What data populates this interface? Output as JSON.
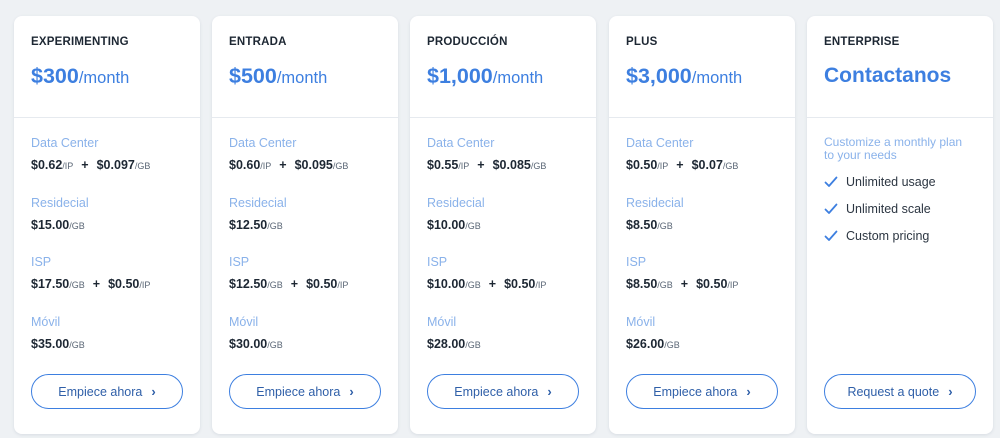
{
  "plans": [
    {
      "tier": "EXPERIMENTING",
      "price": "$300",
      "per": "/month",
      "groups": [
        {
          "label": "Data Center",
          "parts": [
            {
              "value": "$0.62",
              "unit": "/IP"
            },
            {
              "value": "$0.097",
              "unit": "/GB"
            }
          ]
        },
        {
          "label": "Residecial",
          "parts": [
            {
              "value": "$15.00",
              "unit": "/GB"
            }
          ]
        },
        {
          "label": "ISP",
          "parts": [
            {
              "value": "$17.50",
              "unit": "/GB"
            },
            {
              "value": "$0.50",
              "unit": "/IP"
            }
          ]
        },
        {
          "label": "Móvil",
          "parts": [
            {
              "value": "$35.00",
              "unit": "/GB"
            }
          ]
        }
      ],
      "cta": "Empiece ahora"
    },
    {
      "tier": "ENTRADA",
      "price": "$500",
      "per": "/month",
      "groups": [
        {
          "label": "Data Center",
          "parts": [
            {
              "value": "$0.60",
              "unit": "/IP"
            },
            {
              "value": "$0.095",
              "unit": "/GB"
            }
          ]
        },
        {
          "label": "Residecial",
          "parts": [
            {
              "value": "$12.50",
              "unit": "/GB"
            }
          ]
        },
        {
          "label": "ISP",
          "parts": [
            {
              "value": "$12.50",
              "unit": "/GB"
            },
            {
              "value": "$0.50",
              "unit": "/IP"
            }
          ]
        },
        {
          "label": "Móvil",
          "parts": [
            {
              "value": "$30.00",
              "unit": "/GB"
            }
          ]
        }
      ],
      "cta": "Empiece ahora"
    },
    {
      "tier": "PRODUCCIÓN",
      "price": "$1,000",
      "per": "/month",
      "groups": [
        {
          "label": "Data Center",
          "parts": [
            {
              "value": "$0.55",
              "unit": "/IP"
            },
            {
              "value": "$0.085",
              "unit": "/GB"
            }
          ]
        },
        {
          "label": "Residecial",
          "parts": [
            {
              "value": "$10.00",
              "unit": "/GB"
            }
          ]
        },
        {
          "label": "ISP",
          "parts": [
            {
              "value": "$10.00",
              "unit": "/GB"
            },
            {
              "value": "$0.50",
              "unit": "/IP"
            }
          ]
        },
        {
          "label": "Móvil",
          "parts": [
            {
              "value": "$28.00",
              "unit": "/GB"
            }
          ]
        }
      ],
      "cta": "Empiece ahora"
    },
    {
      "tier": "PLUS",
      "price": "$3,000",
      "per": "/month",
      "groups": [
        {
          "label": "Data Center",
          "parts": [
            {
              "value": "$0.50",
              "unit": "/IP"
            },
            {
              "value": "$0.07",
              "unit": "/GB"
            }
          ]
        },
        {
          "label": "Residecial",
          "parts": [
            {
              "value": "$8.50",
              "unit": "/GB"
            }
          ]
        },
        {
          "label": "ISP",
          "parts": [
            {
              "value": "$8.50",
              "unit": "/GB"
            },
            {
              "value": "$0.50",
              "unit": "/IP"
            }
          ]
        },
        {
          "label": "Móvil",
          "parts": [
            {
              "value": "$26.00",
              "unit": "/GB"
            }
          ]
        }
      ],
      "cta": "Empiece ahora"
    }
  ],
  "enterprise": {
    "tier": "ENTERPRISE",
    "price": "Contactanos",
    "description": "Customize a monthly plan to your needs",
    "features": [
      "Unlimited usage",
      "Unlimited scale",
      "Custom pricing"
    ],
    "cta": "Request a quote",
    "check_icon": "check-icon"
  },
  "plus_sign": "+",
  "chevron_icon": "chevron-right-icon",
  "colors": {
    "accent": "#3d7fe0",
    "label": "#8ab2ea",
    "background": "#eef1f4",
    "text": "#1d2733"
  }
}
